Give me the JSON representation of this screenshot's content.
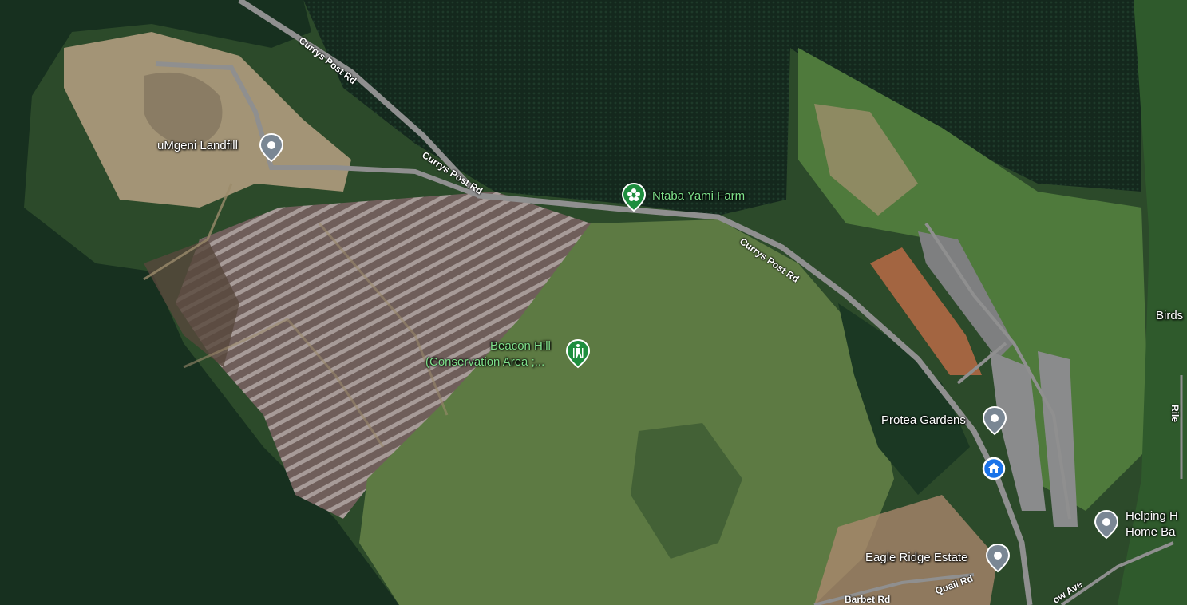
{
  "map": {
    "places": [
      {
        "name": "uMgeni Landfill",
        "type": "generic"
      },
      {
        "name": "Ntaba Yami Farm",
        "type": "park"
      },
      {
        "name": "Beacon Hill",
        "name_line2": "(Conservation Area ;...",
        "type": "hiking"
      },
      {
        "name": "Protea Gardens",
        "type": "generic"
      },
      {
        "name": "Eagle Ridge Estate",
        "type": "generic"
      },
      {
        "name": "Helping H",
        "name_line2": "Home Ba",
        "type": "generic"
      },
      {
        "name": "",
        "type": "home"
      }
    ],
    "roads": [
      "Currys Post Rd",
      "Currys Post Rd",
      "Currys Post Rd",
      "Quail Rd",
      "Barbet Rd",
      "ow Ave",
      "Rile"
    ],
    "edge_labels": [
      "Birds"
    ],
    "colors": {
      "forest": "#143220",
      "grass": "#5d7a43",
      "road": "#8f8f8f",
      "pin_grey": "#7a8794",
      "pin_green": "#1e8e3e",
      "pin_blue": "#1a73e8"
    }
  }
}
